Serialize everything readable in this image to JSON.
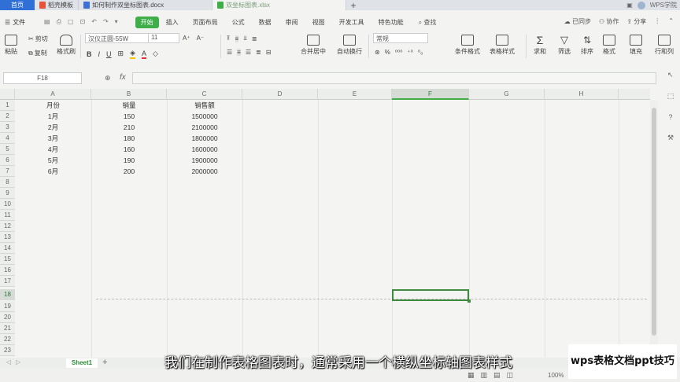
{
  "titlebar": {
    "home": "首页",
    "tabs": [
      {
        "label": "稻壳模板",
        "color": "#e5533a"
      },
      {
        "label": "如何制作双坐标图表.docx",
        "color": "#3b6fd6"
      },
      {
        "label": "双坐标图表.xlsx",
        "color": "#3fae49"
      }
    ],
    "new_tab": "+",
    "user": "WPS学院"
  },
  "menubar": {
    "file": "文件",
    "items": [
      "开始",
      "插入",
      "页面布局",
      "公式",
      "数据",
      "审阅",
      "视图",
      "开发工具",
      "特色功能"
    ],
    "active_index": 0,
    "search": "查找",
    "right": [
      "已同步",
      "协作",
      "分享"
    ]
  },
  "ribbon": {
    "paste": "粘贴",
    "cut": "剪切",
    "copy": "复制",
    "format_painter": "格式刷",
    "font_name": "汉仪正圆-55W",
    "font_size": "11",
    "merge": "合并居中",
    "wrap": "自动换行",
    "number_format": "常规",
    "cond_format": "条件格式",
    "table_style": "表格样式",
    "sum": "求和",
    "filter": "筛选",
    "sort": "排序",
    "format": "格式",
    "fill": "填充",
    "rowcol": "行和列"
  },
  "formulabar": {
    "cell_ref": "F18",
    "fx": "fx",
    "formula": ""
  },
  "sheet": {
    "columns": [
      "A",
      "B",
      "C",
      "D",
      "E",
      "F",
      "G",
      "H"
    ],
    "selected_column": "F",
    "rows": [
      "1",
      "2",
      "3",
      "4",
      "5",
      "6",
      "7",
      "8",
      "9",
      "10",
      "11",
      "12",
      "13",
      "14",
      "15",
      "16",
      "17",
      "18",
      "19",
      "20",
      "21",
      "22",
      "23"
    ],
    "selected_row": "18",
    "headers": [
      "月份",
      "销量",
      "销售额"
    ],
    "data": [
      [
        "1月",
        "150",
        "1500000"
      ],
      [
        "2月",
        "210",
        "2100000"
      ],
      [
        "3月",
        "180",
        "1800000"
      ],
      [
        "4月",
        "160",
        "1600000"
      ],
      [
        "5月",
        "190",
        "1900000"
      ],
      [
        "6月",
        "200",
        "2000000"
      ]
    ]
  },
  "sheetbar": {
    "sheet_name": "Sheet1",
    "add": "+"
  },
  "statusbar": {
    "zoom": "100%"
  },
  "overlay": {
    "subtitle": "我们在制作表格图表时，通常采用一个横纵坐标轴图表样式",
    "watermark": "wps表格文档ppt技巧"
  }
}
